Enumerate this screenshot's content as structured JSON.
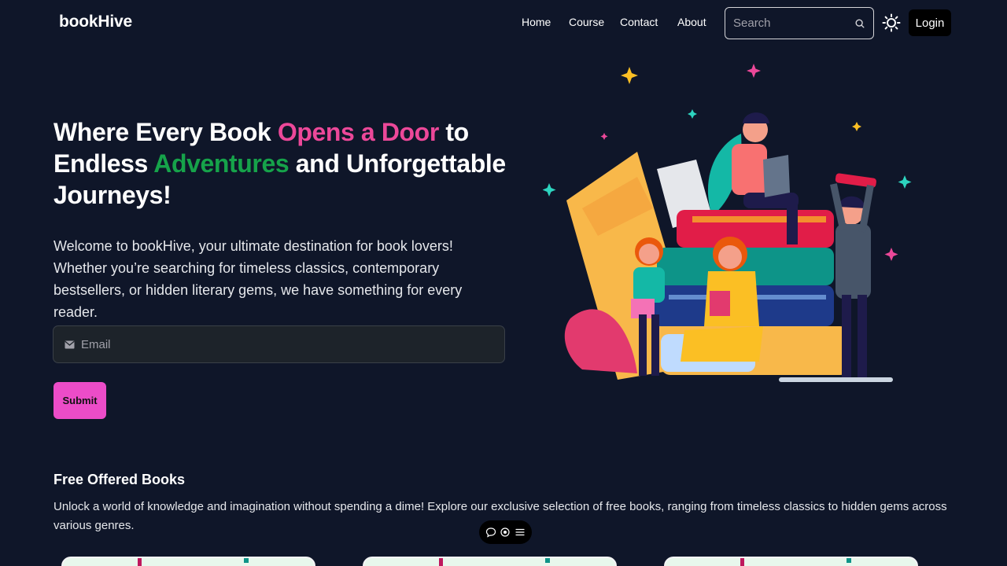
{
  "nav": {
    "logo": "bookHive",
    "links": [
      "Home",
      "Course",
      "Contact",
      "About"
    ],
    "search_placeholder": "Search",
    "login_label": "Login"
  },
  "hero": {
    "title_part1": "Where Every Book ",
    "title_highlight1": "Opens a Door",
    "title_part2": " to Endless ",
    "title_highlight2": "Adventures",
    "title_part3": " and Unforgettable Journeys!",
    "description": "Welcome to bookHive, your ultimate destination for book lovers! Whether you’re searching for timeless classics, contemporary bestsellers, or hidden literary gems, we have something for every reader.",
    "email_placeholder": "Email",
    "submit_label": "Submit"
  },
  "free_books": {
    "title": "Free Offered Books",
    "description": "Unlock a world of knowledge and imagination without spending a dime! Explore our exclusive selection of free books, ranging from timeless classics to hidden gems across various genres."
  },
  "colors": {
    "background": "#0f1629",
    "accent_pink": "#ec4899",
    "accent_green": "#16a34a",
    "submit_bg": "#ec4cc8"
  },
  "icons": {
    "search": "search-icon",
    "theme": "sun-icon",
    "email": "envelope-icon",
    "toolbar": [
      "chat-bubble-icon",
      "eye-icon",
      "list-icon"
    ]
  }
}
